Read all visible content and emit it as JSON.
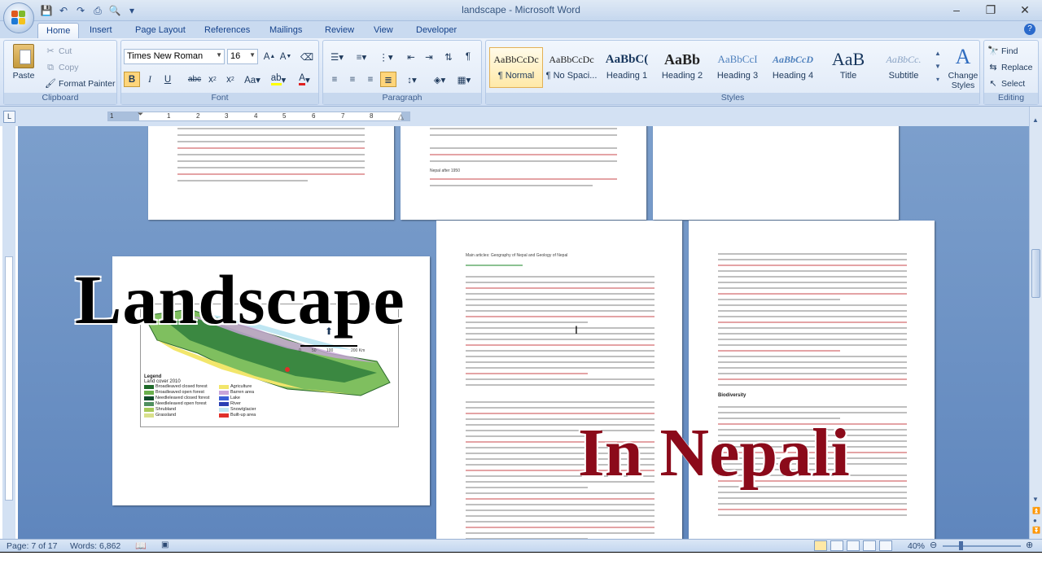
{
  "window": {
    "title": "landscape - Microsoft Word",
    "minimize": "–",
    "restore": "❐",
    "close": "✕"
  },
  "tabs": [
    "Home",
    "Insert",
    "Page Layout",
    "References",
    "Mailings",
    "Review",
    "View",
    "Developer"
  ],
  "active_tab": "Home",
  "clipboard": {
    "paste": "Paste",
    "cut": "Cut",
    "copy": "Copy",
    "format_painter": "Format Painter",
    "label": "Clipboard"
  },
  "font": {
    "family": "Times New Roman",
    "size": "16",
    "label": "Font"
  },
  "paragraph": {
    "label": "Paragraph"
  },
  "styles": {
    "items": [
      {
        "sample": "AaBbCcDc",
        "name": "¶ Normal"
      },
      {
        "sample": "AaBbCcDc",
        "name": "¶ No Spaci..."
      },
      {
        "sample": "AaBbC(",
        "name": "Heading 1"
      },
      {
        "sample": "AaBb",
        "name": "Heading 2"
      },
      {
        "sample": "AaBbCcI",
        "name": "Heading 3"
      },
      {
        "sample": "AaBbCcD",
        "name": "Heading 4"
      },
      {
        "sample": "AaB",
        "name": "Title"
      },
      {
        "sample": "AaBbCc.",
        "name": "Subtitle"
      }
    ],
    "change_styles": "Change Styles",
    "label": "Styles"
  },
  "editing": {
    "find": "Find",
    "replace": "Replace",
    "select": "Select",
    "label": "Editing"
  },
  "ruler": {
    "ticks": [
      "1",
      "1",
      "2",
      "3",
      "4",
      "5",
      "6",
      "7",
      "8"
    ]
  },
  "document": {
    "overlay_title": "Landscape",
    "overlay_subtitle": "In Nepali",
    "page3_heading": "Nepal after 1950",
    "page4_heading": "Main articles: Geography of Nepal and Geology of Nepal",
    "page5_heading": "Biodiversity",
    "map": {
      "legend_title": "Legend",
      "legend_subtitle": "Land cover 2010",
      "legend_items": [
        {
          "label": "Broadleaved closed forest",
          "color": "#1f6b2a"
        },
        {
          "label": "Broadleaved open forest",
          "color": "#6ab04c"
        },
        {
          "label": "Needleleaved closed forest",
          "color": "#0f4a2a"
        },
        {
          "label": "Needleleaved open forest",
          "color": "#4f8f5f"
        },
        {
          "label": "Shrubland",
          "color": "#a6c858"
        },
        {
          "label": "Grassland",
          "color": "#d9e08c"
        },
        {
          "label": "Agriculture",
          "color": "#f2e66b"
        },
        {
          "label": "Barren area",
          "color": "#c9a5d9"
        },
        {
          "label": "Lake",
          "color": "#3c5fd6"
        },
        {
          "label": "River",
          "color": "#2a3fb3"
        },
        {
          "label": "Snow/glacier",
          "color": "#bfe6f2"
        },
        {
          "label": "Built-up area",
          "color": "#e0302a"
        }
      ],
      "scale": [
        "0",
        "50",
        "100",
        "200 Km"
      ]
    }
  },
  "status": {
    "page": "Page: 7 of 17",
    "words": "Words: 6,862",
    "zoom": "40%"
  },
  "colors": {
    "ribbon_bg": "#dae6f6",
    "doc_bg": "#6b8fc0",
    "nepali_text": "#8b0a1a"
  }
}
